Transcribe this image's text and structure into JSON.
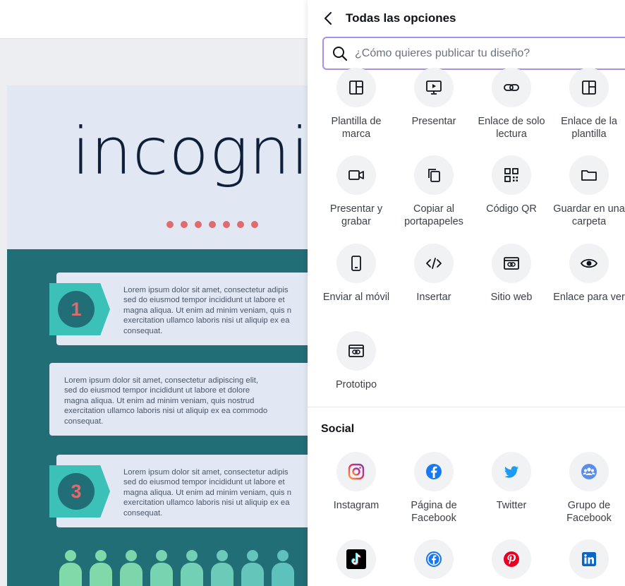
{
  "panel": {
    "title": "Todas las opciones",
    "search_placeholder": "¿Cómo quieres publicar tu diseño?"
  },
  "share_items": [
    {
      "label": "Plantilla de marca",
      "icon": "brand-template-icon"
    },
    {
      "label": "Presentar",
      "icon": "present-icon"
    },
    {
      "label": "Enlace de solo lectura",
      "icon": "link-icon"
    },
    {
      "label": "Enlace de la plantilla",
      "icon": "template-link-icon"
    },
    {
      "label": "Presentar y grabar",
      "icon": "camera-icon"
    },
    {
      "label": "Copiar al portapapeles",
      "icon": "copy-icon"
    },
    {
      "label": "Código QR",
      "icon": "qr-code-icon"
    },
    {
      "label": "Guardar en una carpeta",
      "icon": "folder-icon"
    },
    {
      "label": "Enviar al móvil",
      "icon": "mobile-icon"
    },
    {
      "label": "Insertar",
      "icon": "embed-code-icon"
    },
    {
      "label": "Sitio web",
      "icon": "website-icon"
    },
    {
      "label": "Enlace para ver",
      "icon": "eye-icon"
    },
    {
      "label": "Prototipo",
      "icon": "prototype-icon"
    }
  ],
  "social": {
    "title": "Social",
    "items": [
      {
        "label": "Instagram",
        "icon": "instagram-icon"
      },
      {
        "label": "Página de Facebook",
        "icon": "facebook-icon"
      },
      {
        "label": "Twitter",
        "icon": "twitter-icon"
      },
      {
        "label": "Grupo de Facebook",
        "icon": "facebook-group-icon"
      },
      {
        "label": "",
        "icon": "tiktok-icon"
      },
      {
        "label": "",
        "icon": "facebook-messenger-icon"
      },
      {
        "label": "",
        "icon": "pinterest-icon"
      },
      {
        "label": "",
        "icon": "linkedin-icon"
      }
    ]
  },
  "design": {
    "logo_text": "incognit",
    "card1_number": "1",
    "card1_text": "Lorem ipsum dolor sit amet, consectetur adipis\nsed do eiusmod tempor incididunt ut labore et\nmagna aliqua. Ut enim ad minim veniam, quis n\nexercitation ullamco laboris nisi ut aliquip ex ea\nconsequat.",
    "card2_text": "Lorem ipsum dolor sit amet, consectetur adipiscing elit,\nsed do eiusmod tempor incididunt ut labore et dolore\nmagna aliqua. Ut enim ad minim veniam, quis nostrud\nexercitation ullamco laboris nisi ut aliquip ex ea commodo\nconsequat.",
    "card3_number": "3",
    "card3_text": "Lorem ipsum dolor sit amet, consectetur adipis\nsed do eiusmod tempor incididunt ut labore et\nmagna aliqua. Ut enim ad minim veniam, quis n\nexercitation ullamco laboris nisi ut aliquip ex ea\nconsequat."
  },
  "colors": {
    "accent_purple": "#a98fe6",
    "teal_dark": "#226e76",
    "teal_light": "#3cc1b8",
    "coral": "#e06a6e"
  }
}
